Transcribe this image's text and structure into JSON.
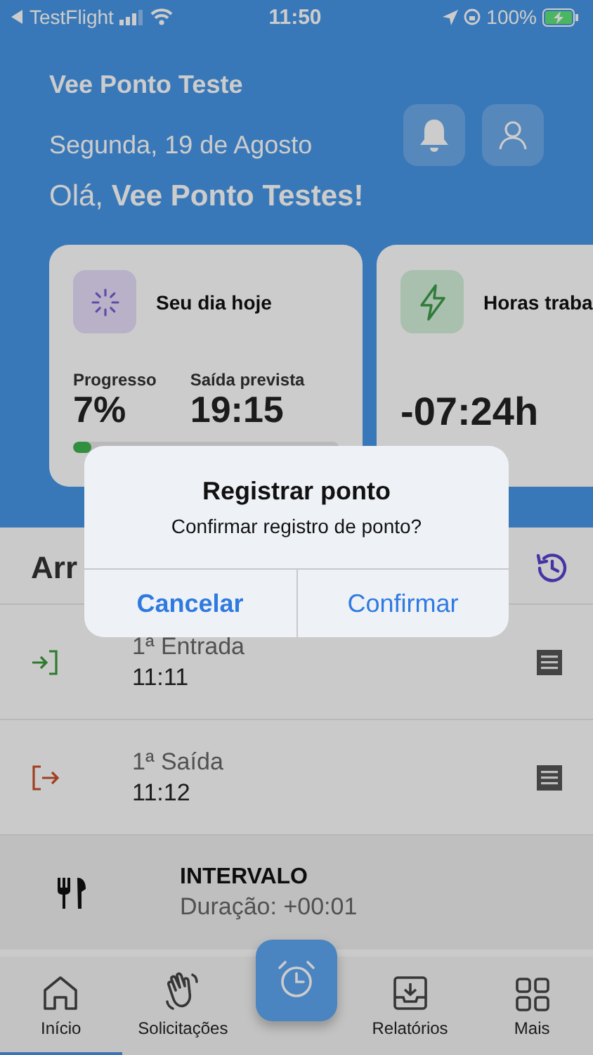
{
  "status_bar": {
    "back_label": "TestFlight",
    "time": "11:50",
    "battery": "100%"
  },
  "header": {
    "title": "Vee Ponto Teste",
    "date": "Segunda, 19 de Agosto",
    "greeting": "Olá, **Vee Ponto Testes!**"
  },
  "cards": [
    {
      "kind": "today",
      "title": "Seu dia hoje",
      "stats": [
        {
          "label": "Progresso",
          "value": "7%"
        },
        {
          "label": "Saída prevista",
          "value": "19:15"
        }
      ],
      "level": 0.07
    },
    {
      "kind": "hours",
      "title": "Horas traba",
      "value": "-07:24h"
    }
  ],
  "section": {
    "title": "Arr"
  },
  "entries": [
    {
      "kind": "entry",
      "label": "1ª Entrada",
      "time": "11:11"
    },
    {
      "kind": "exit",
      "label": "1ª Saída",
      "time": "11:12"
    },
    {
      "kind": "break",
      "label": "INTERVALO",
      "time": "Duração: +00:01"
    }
  ],
  "tabs": [
    {
      "kind": "home",
      "label": "Início",
      "selected": true
    },
    {
      "kind": "requests",
      "label": "Solicitações",
      "selected": false
    },
    {
      "kind": "clock",
      "selected": false
    },
    {
      "kind": "reports",
      "label": "Relatórios",
      "selected": false
    },
    {
      "kind": "more",
      "label": "Mais",
      "selected": false
    }
  ],
  "dialog": {
    "title": "Registrar ponto",
    "message": "Confirmar registro de ponto?",
    "buttons": [
      {
        "label": "Cancelar",
        "kind": "cancel"
      },
      {
        "label": "Confirmar",
        "kind": "default"
      }
    ]
  }
}
